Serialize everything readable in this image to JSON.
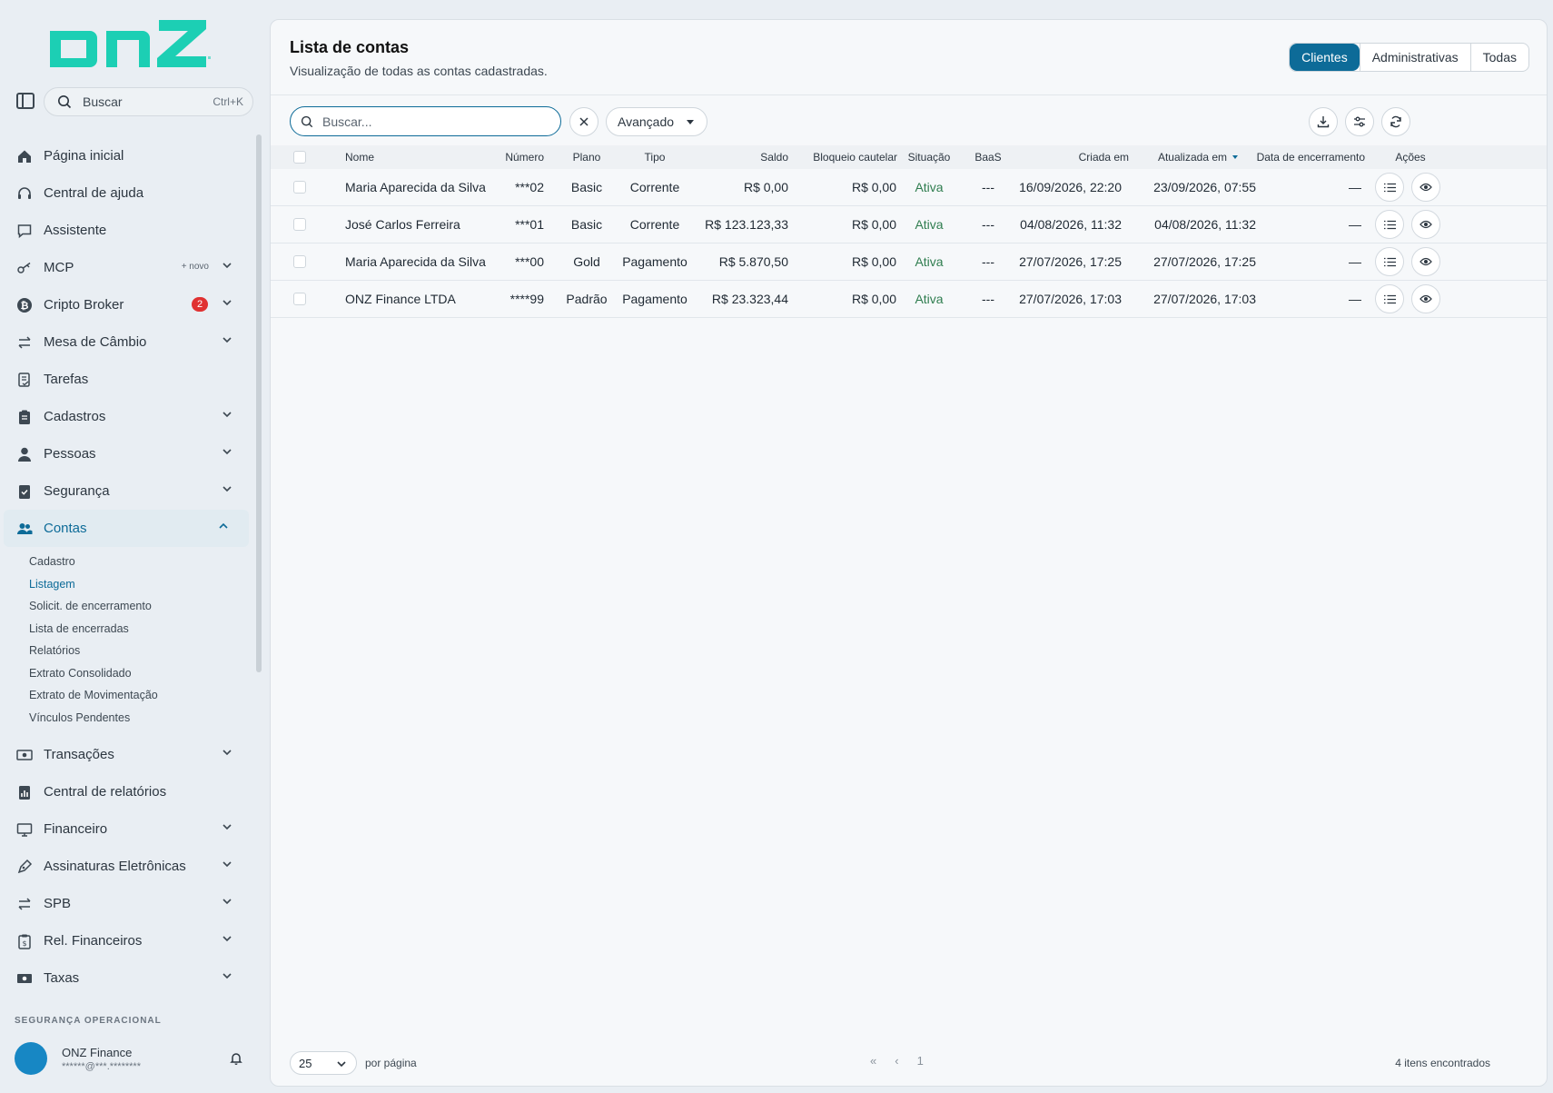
{
  "brand": {
    "logo_text": "onz",
    "accent": "#1ccfb4",
    "primary": "#0d6b98"
  },
  "sidebar": {
    "search_label": "Buscar",
    "search_shortcut": "Ctrl+K",
    "items": [
      {
        "label": "Página inicial",
        "icon": "home-icon"
      },
      {
        "label": "Central de ajuda",
        "icon": "headset-icon"
      },
      {
        "label": "Assistente",
        "icon": "chat-icon"
      },
      {
        "label": "MCP",
        "icon": "key-icon",
        "tag": "+ novo"
      },
      {
        "label": "Cripto Broker",
        "icon": "bitcoin-icon",
        "badge": "2"
      },
      {
        "label": "Mesa de Câmbio",
        "icon": "exchange-icon"
      },
      {
        "label": "Tarefas",
        "icon": "tasks-icon"
      },
      {
        "label": "Cadastros",
        "icon": "clipboard-icon"
      },
      {
        "label": "Pessoas",
        "icon": "person-icon"
      },
      {
        "label": "Segurança",
        "icon": "shield-check-icon"
      },
      {
        "label": "Contas",
        "icon": "users-icon"
      },
      {
        "label": "Transações",
        "icon": "money-icon"
      },
      {
        "label": "Central de relatórios",
        "icon": "report-icon"
      },
      {
        "label": "Financeiro",
        "icon": "finance-icon"
      },
      {
        "label": "Assinaturas Eletrônicas",
        "icon": "pen-icon"
      },
      {
        "label": "SPB",
        "icon": "exchange-icon"
      },
      {
        "label": "Rel. Financeiros",
        "icon": "clipboard-money-icon"
      },
      {
        "label": "Taxas",
        "icon": "cash-icon"
      }
    ],
    "contas_sub": [
      "Cadastro",
      "Listagem",
      "Solicit. de encerramento",
      "Lista de encerradas",
      "Relatórios",
      "Extrato Consolidado",
      "Extrato de Movimentação",
      "Vínculos Pendentes"
    ],
    "section_label": "SEGURANÇA OPERACIONAL",
    "user": {
      "name": "ONZ Finance",
      "email": "******@***.********"
    }
  },
  "main": {
    "title": "Lista de contas",
    "subtitle": "Visualização de todas as contas cadastradas.",
    "tabs": [
      "Clientes",
      "Administrativas",
      "Todas"
    ],
    "active_tab": "Clientes",
    "search_placeholder": "Buscar...",
    "advanced_label": "Avançado",
    "columns": [
      "Nome",
      "Número",
      "Plano",
      "Tipo",
      "Saldo",
      "Bloqueio cautelar",
      "Situação",
      "BaaS",
      "Criada em",
      "Atualizada em",
      "Data de encerramento",
      "Ações"
    ],
    "rows": [
      {
        "nome": "Maria Aparecida da Silva",
        "numero": "***02",
        "plano": "Basic",
        "tipo": "Corrente",
        "saldo": "R$ 0,00",
        "bloqueio": "R$ 0,00",
        "situacao": "Ativa",
        "baas": "---",
        "criada": "16/09/2026, 22:20",
        "atualizada": "23/09/2026, 07:55",
        "encerramento": "—"
      },
      {
        "nome": "José Carlos Ferreira",
        "numero": "***01",
        "plano": "Basic",
        "tipo": "Corrente",
        "saldo": "R$ 123.123,33",
        "bloqueio": "R$ 0,00",
        "situacao": "Ativa",
        "baas": "---",
        "criada": "04/08/2026, 11:32",
        "atualizada": "04/08/2026, 11:32",
        "encerramento": "—"
      },
      {
        "nome": "Maria Aparecida da Silva",
        "numero": "***00",
        "plano": "Gold",
        "tipo": "Pagamento",
        "saldo": "R$ 5.870,50",
        "bloqueio": "R$ 0,00",
        "situacao": "Ativa",
        "baas": "---",
        "criada": "27/07/2026, 17:25",
        "atualizada": "27/07/2026, 17:25",
        "encerramento": "—"
      },
      {
        "nome": "ONZ Finance LTDA",
        "numero": "****99",
        "plano": "Padrão",
        "tipo": "Pagamento",
        "saldo": "R$ 23.323,44",
        "bloqueio": "R$ 0,00",
        "situacao": "Ativa",
        "baas": "---",
        "criada": "27/07/2026, 17:03",
        "atualizada": "27/07/2026, 17:03",
        "encerramento": "—"
      }
    ],
    "footer": {
      "per_page_value": "25",
      "per_page_label": "por página",
      "current_page": "1",
      "found_text": "4 itens encontrados"
    }
  }
}
